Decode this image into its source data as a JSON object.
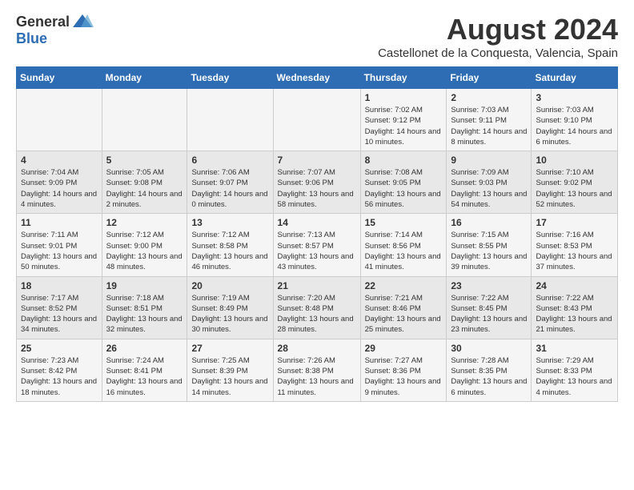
{
  "header": {
    "logo_general": "General",
    "logo_blue": "Blue",
    "title": "August 2024",
    "subtitle": "Castellonet de la Conquesta, Valencia, Spain"
  },
  "calendar": {
    "days_of_week": [
      "Sunday",
      "Monday",
      "Tuesday",
      "Wednesday",
      "Thursday",
      "Friday",
      "Saturday"
    ],
    "weeks": [
      [
        {
          "day": "",
          "info": ""
        },
        {
          "day": "",
          "info": ""
        },
        {
          "day": "",
          "info": ""
        },
        {
          "day": "",
          "info": ""
        },
        {
          "day": "1",
          "info": "Sunrise: 7:02 AM\nSunset: 9:12 PM\nDaylight: 14 hours\nand 10 minutes."
        },
        {
          "day": "2",
          "info": "Sunrise: 7:03 AM\nSunset: 9:11 PM\nDaylight: 14 hours\nand 8 minutes."
        },
        {
          "day": "3",
          "info": "Sunrise: 7:03 AM\nSunset: 9:10 PM\nDaylight: 14 hours\nand 6 minutes."
        }
      ],
      [
        {
          "day": "4",
          "info": "Sunrise: 7:04 AM\nSunset: 9:09 PM\nDaylight: 14 hours\nand 4 minutes."
        },
        {
          "day": "5",
          "info": "Sunrise: 7:05 AM\nSunset: 9:08 PM\nDaylight: 14 hours\nand 2 minutes."
        },
        {
          "day": "6",
          "info": "Sunrise: 7:06 AM\nSunset: 9:07 PM\nDaylight: 14 hours\nand 0 minutes."
        },
        {
          "day": "7",
          "info": "Sunrise: 7:07 AM\nSunset: 9:06 PM\nDaylight: 13 hours\nand 58 minutes."
        },
        {
          "day": "8",
          "info": "Sunrise: 7:08 AM\nSunset: 9:05 PM\nDaylight: 13 hours\nand 56 minutes."
        },
        {
          "day": "9",
          "info": "Sunrise: 7:09 AM\nSunset: 9:03 PM\nDaylight: 13 hours\nand 54 minutes."
        },
        {
          "day": "10",
          "info": "Sunrise: 7:10 AM\nSunset: 9:02 PM\nDaylight: 13 hours\nand 52 minutes."
        }
      ],
      [
        {
          "day": "11",
          "info": "Sunrise: 7:11 AM\nSunset: 9:01 PM\nDaylight: 13 hours\nand 50 minutes."
        },
        {
          "day": "12",
          "info": "Sunrise: 7:12 AM\nSunset: 9:00 PM\nDaylight: 13 hours\nand 48 minutes."
        },
        {
          "day": "13",
          "info": "Sunrise: 7:12 AM\nSunset: 8:58 PM\nDaylight: 13 hours\nand 46 minutes."
        },
        {
          "day": "14",
          "info": "Sunrise: 7:13 AM\nSunset: 8:57 PM\nDaylight: 13 hours\nand 43 minutes."
        },
        {
          "day": "15",
          "info": "Sunrise: 7:14 AM\nSunset: 8:56 PM\nDaylight: 13 hours\nand 41 minutes."
        },
        {
          "day": "16",
          "info": "Sunrise: 7:15 AM\nSunset: 8:55 PM\nDaylight: 13 hours\nand 39 minutes."
        },
        {
          "day": "17",
          "info": "Sunrise: 7:16 AM\nSunset: 8:53 PM\nDaylight: 13 hours\nand 37 minutes."
        }
      ],
      [
        {
          "day": "18",
          "info": "Sunrise: 7:17 AM\nSunset: 8:52 PM\nDaylight: 13 hours\nand 34 minutes."
        },
        {
          "day": "19",
          "info": "Sunrise: 7:18 AM\nSunset: 8:51 PM\nDaylight: 13 hours\nand 32 minutes."
        },
        {
          "day": "20",
          "info": "Sunrise: 7:19 AM\nSunset: 8:49 PM\nDaylight: 13 hours\nand 30 minutes."
        },
        {
          "day": "21",
          "info": "Sunrise: 7:20 AM\nSunset: 8:48 PM\nDaylight: 13 hours\nand 28 minutes."
        },
        {
          "day": "22",
          "info": "Sunrise: 7:21 AM\nSunset: 8:46 PM\nDaylight: 13 hours\nand 25 minutes."
        },
        {
          "day": "23",
          "info": "Sunrise: 7:22 AM\nSunset: 8:45 PM\nDaylight: 13 hours\nand 23 minutes."
        },
        {
          "day": "24",
          "info": "Sunrise: 7:22 AM\nSunset: 8:43 PM\nDaylight: 13 hours\nand 21 minutes."
        }
      ],
      [
        {
          "day": "25",
          "info": "Sunrise: 7:23 AM\nSunset: 8:42 PM\nDaylight: 13 hours\nand 18 minutes."
        },
        {
          "day": "26",
          "info": "Sunrise: 7:24 AM\nSunset: 8:41 PM\nDaylight: 13 hours\nand 16 minutes."
        },
        {
          "day": "27",
          "info": "Sunrise: 7:25 AM\nSunset: 8:39 PM\nDaylight: 13 hours\nand 14 minutes."
        },
        {
          "day": "28",
          "info": "Sunrise: 7:26 AM\nSunset: 8:38 PM\nDaylight: 13 hours\nand 11 minutes."
        },
        {
          "day": "29",
          "info": "Sunrise: 7:27 AM\nSunset: 8:36 PM\nDaylight: 13 hours\nand 9 minutes."
        },
        {
          "day": "30",
          "info": "Sunrise: 7:28 AM\nSunset: 8:35 PM\nDaylight: 13 hours\nand 6 minutes."
        },
        {
          "day": "31",
          "info": "Sunrise: 7:29 AM\nSunset: 8:33 PM\nDaylight: 13 hours\nand 4 minutes."
        }
      ]
    ]
  }
}
